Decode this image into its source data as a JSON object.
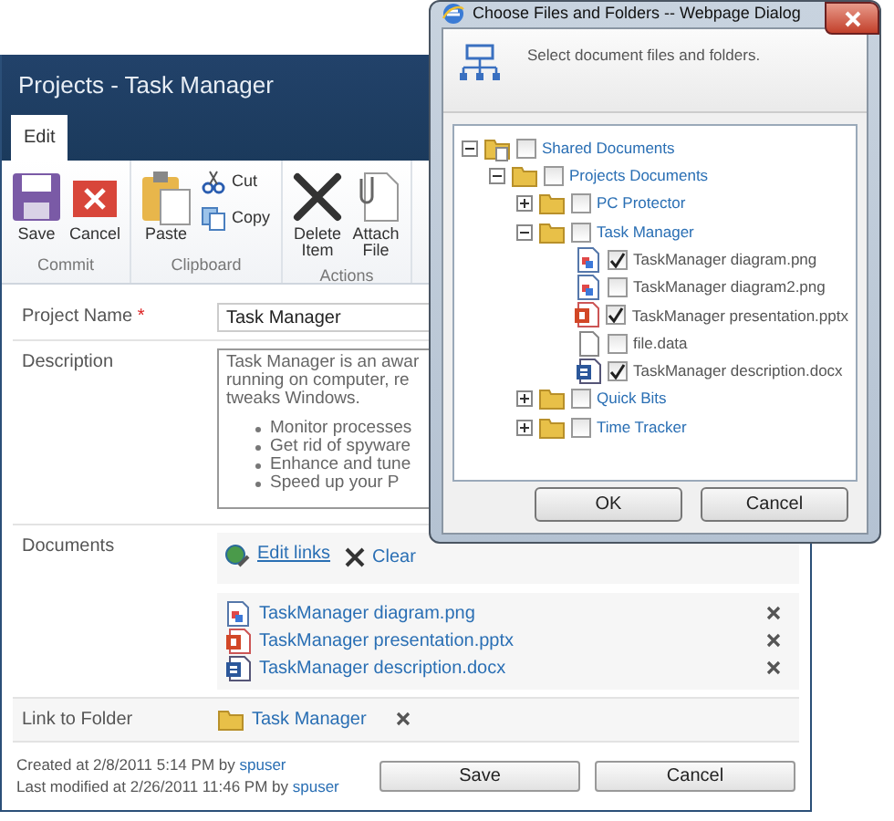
{
  "page": {
    "title": "Projects - Task Manager",
    "tabs": [
      {
        "label": "Edit",
        "selected": true
      }
    ],
    "ribbon_groups": [
      {
        "label": "Commit",
        "buttons": [
          {
            "label": "Save"
          },
          {
            "label": "Cancel"
          }
        ]
      },
      {
        "label": "Clipboard",
        "buttons": [
          {
            "label": "Paste"
          }
        ],
        "small_buttons": [
          {
            "label": "Cut"
          },
          {
            "label": "Copy"
          }
        ]
      },
      {
        "label": "Actions",
        "buttons": [
          {
            "label": "Delete Item"
          },
          {
            "label": "Attach File"
          }
        ]
      }
    ],
    "form": [
      {
        "kind": "text",
        "label": "Project Name",
        "required_mark": "*",
        "value": "Task Manager"
      },
      {
        "kind": "richtext",
        "label": "Description",
        "lines": [
          "Task Manager is an awar",
          "running on computer, re",
          "tweaks Windows."
        ],
        "bullets": [
          "Monitor processes",
          "Get rid of spyware",
          "Enhance and tune",
          "Speed up your P"
        ]
      },
      {
        "kind": "documents",
        "label": "Documents",
        "actions": [
          {
            "label": "Edit links"
          },
          {
            "label": "Clear"
          }
        ],
        "files": [
          {
            "name": "TaskManager diagram.png",
            "kind": "png"
          },
          {
            "name": "TaskManager presentation.pptx",
            "kind": "pptx"
          },
          {
            "name": "TaskManager description.docx",
            "kind": "docx"
          }
        ]
      },
      {
        "kind": "folder",
        "label": "Link to Folder",
        "value": "Task Manager"
      }
    ],
    "footer": {
      "lines": [
        {
          "text": "Created at 2/8/2011 5:14 PM by",
          "user": "spuser"
        },
        {
          "text": "Last modified at 2/26/2011 11:46 PM by",
          "user": "spuser"
        }
      ],
      "buttons": [
        "Save",
        "Cancel"
      ]
    }
  },
  "dialog": {
    "title": "Choose Files and Folders -- Webpage Dialog",
    "instruction": "Select document files and folders.",
    "tree": [
      {
        "label": "Shared Documents",
        "kind": "library",
        "expanded": true,
        "checked": false,
        "children": [
          {
            "label": "Projects Documents",
            "kind": "folder",
            "expanded": true,
            "checked": false,
            "children": [
              {
                "label": "PC Protector",
                "kind": "folder",
                "expanded": false,
                "checked": false
              },
              {
                "label": "Task Manager",
                "kind": "folder",
                "expanded": true,
                "checked": false,
                "children": [
                  {
                    "label": "TaskManager diagram.png",
                    "kind": "png",
                    "checked": true
                  },
                  {
                    "label": "TaskManager diagram2.png",
                    "kind": "png",
                    "checked": false
                  },
                  {
                    "label": "TaskManager presentation.pptx",
                    "kind": "pptx",
                    "checked": true
                  },
                  {
                    "label": "file.data",
                    "kind": "data",
                    "checked": false
                  },
                  {
                    "label": "TaskManager description.docx",
                    "kind": "docx",
                    "checked": true
                  }
                ]
              },
              {
                "label": "Quick Bits",
                "kind": "folder",
                "expanded": false,
                "checked": false
              },
              {
                "label": "Time Tracker",
                "kind": "folder",
                "expanded": false,
                "checked": false
              }
            ]
          }
        ]
      }
    ],
    "buttons": [
      "OK",
      "Cancel"
    ]
  }
}
